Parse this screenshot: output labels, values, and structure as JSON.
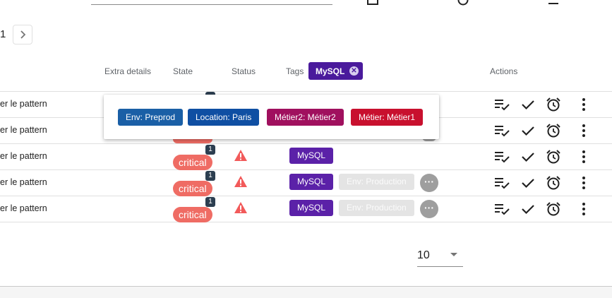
{
  "pagination": {
    "current_page": "1",
    "next_icon": "chevron-right-icon"
  },
  "table": {
    "headers": {
      "extra_details": "Extra details",
      "state": "State",
      "status": "Status",
      "tags": "Tags",
      "actions": "Actions"
    },
    "active_tag_filter": "MySQL",
    "rows": [
      {
        "text": "er le pattern"
      },
      {
        "text": "er le pattern"
      },
      {
        "text": "er le pattern",
        "severity": "critical",
        "count": "1",
        "tags": [
          "MySQL"
        ]
      },
      {
        "text": "er le pattern",
        "severity": "critical",
        "count": "1",
        "tags": [
          "MySQL",
          "Env: Production"
        ],
        "more": "···"
      },
      {
        "text": "er le pattern",
        "severity": "critical",
        "count": "1",
        "tags": [
          "MySQL",
          "Env: Production"
        ],
        "more": "···"
      }
    ]
  },
  "popover": {
    "tags": [
      {
        "label": "Env: Preprod",
        "color": "#1a5fa6"
      },
      {
        "label": "Location: Paris",
        "color": "#0f4fa3"
      },
      {
        "label": "Métier2: Métier2",
        "color": "#a0105e"
      },
      {
        "label": "Métier: Métier1",
        "color": "#c8102e"
      }
    ]
  },
  "page_size": {
    "value": "10"
  },
  "colors": {
    "mysql": "#5b21a8",
    "critical": "#ef6c64",
    "warning": "#f25a5a"
  }
}
